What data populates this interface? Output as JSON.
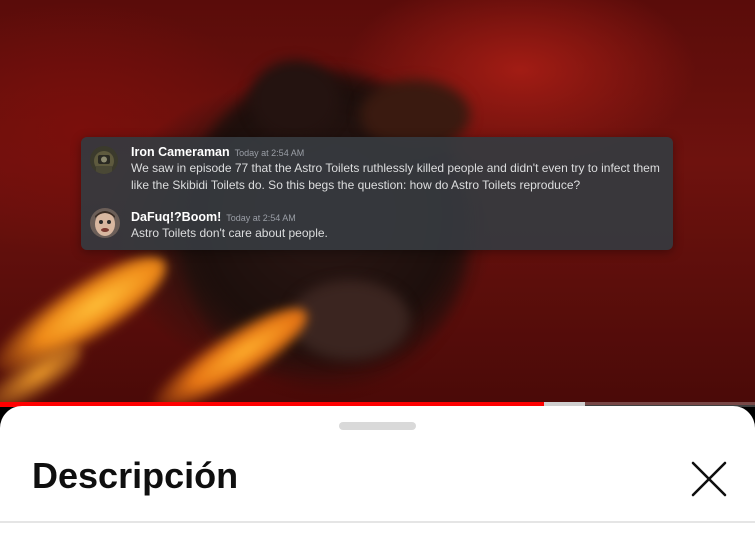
{
  "video": {
    "chat": {
      "messages": [
        {
          "author": "Iron Cameraman",
          "time": "Today at 2:54 AM",
          "text": "We saw in episode 77 that the Astro Toilets ruthlessly killed people and didn't even try to infect them like the Skibidi Toilets do. So this begs the question: how do Astro Toilets reproduce?",
          "avatar_icon": "camera-head-avatar"
        },
        {
          "author": "DaFuq!?Boom!",
          "time": "Today at 2:54 AM",
          "text": "Astro Toilets don't care about people.",
          "avatar_icon": "cartoon-face-avatar"
        }
      ]
    },
    "progress": {
      "played_fraction": 0.72,
      "buffered_fraction": 0.775,
      "played_color": "#ff0000"
    }
  },
  "sheet": {
    "title": "Descripción",
    "close_icon": "close-icon"
  }
}
